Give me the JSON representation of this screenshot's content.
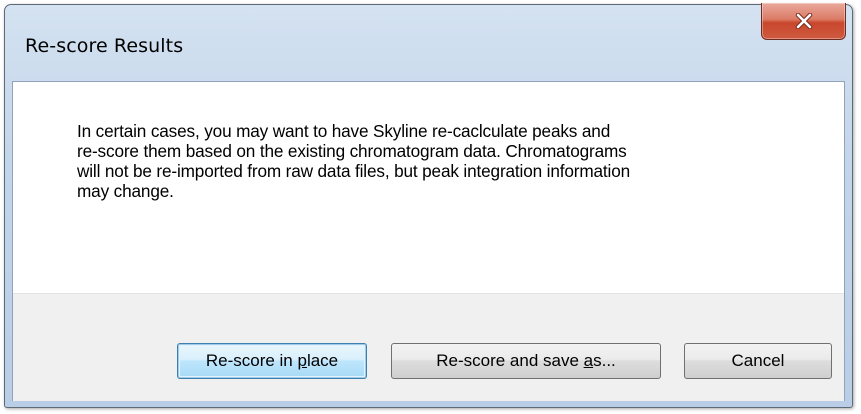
{
  "window": {
    "title": "Re-score Results"
  },
  "message": {
    "lines": [
      "In certain cases, you may want to have Skyline re-caclculate peaks and",
      "re-score them based on the existing chromatogram data.  Chromatograms",
      "will not be re-imported from raw data files, but peak integration information",
      "may change."
    ]
  },
  "buttons": {
    "rescore_in_place": {
      "prefix": "Re-score in ",
      "mnemonic": "p",
      "suffix": "lace"
    },
    "rescore_and_save": {
      "prefix": "Re-score and save ",
      "mnemonic": "a",
      "suffix": "s..."
    },
    "cancel": {
      "label": "Cancel"
    }
  },
  "colors": {
    "close_button": "#c8472c",
    "title_bar": "#c3d5ea",
    "button_panel": "#f0f0f0",
    "default_button_border": "#3c7fb1"
  },
  "icons": {
    "close": "close-icon"
  }
}
